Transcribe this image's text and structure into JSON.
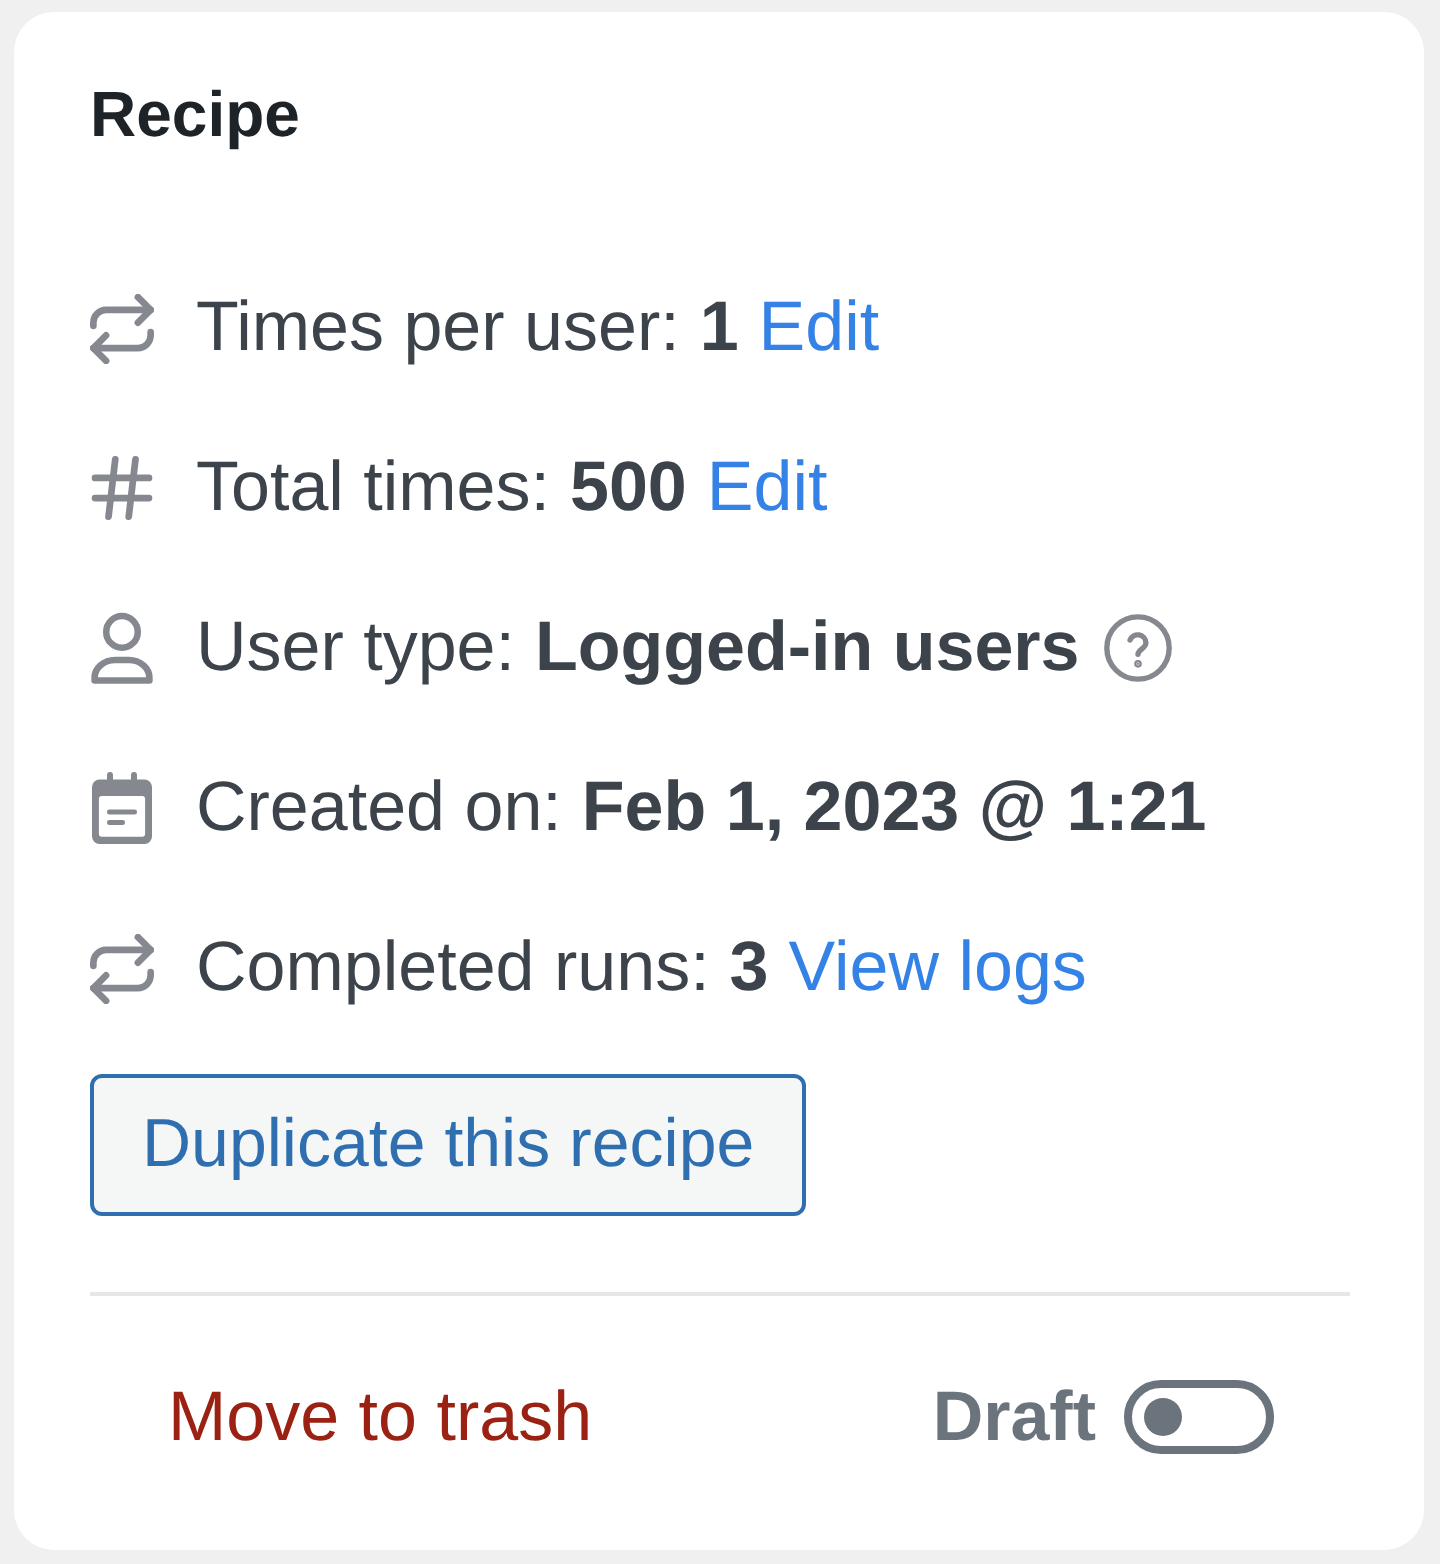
{
  "card": {
    "title": "Recipe"
  },
  "details": [
    {
      "kind": "repeat",
      "label": "Times per user:",
      "value": "1",
      "link": "Edit"
    },
    {
      "kind": "hash",
      "label": "Total times:",
      "value": "500",
      "link": "Edit"
    },
    {
      "kind": "user",
      "label": "User type:",
      "value": "Logged-in users",
      "help": true
    },
    {
      "kind": "calendar",
      "label": "Created on:",
      "value": "Feb 1, 2023 @ 1:21"
    },
    {
      "kind": "repeat",
      "label": "Completed runs:",
      "value": "3",
      "link": "View logs"
    }
  ],
  "duplicate_button": "Duplicate this recipe",
  "footer": {
    "trash_link": "Move to trash",
    "status": {
      "label": "Draft",
      "on": false
    }
  }
}
